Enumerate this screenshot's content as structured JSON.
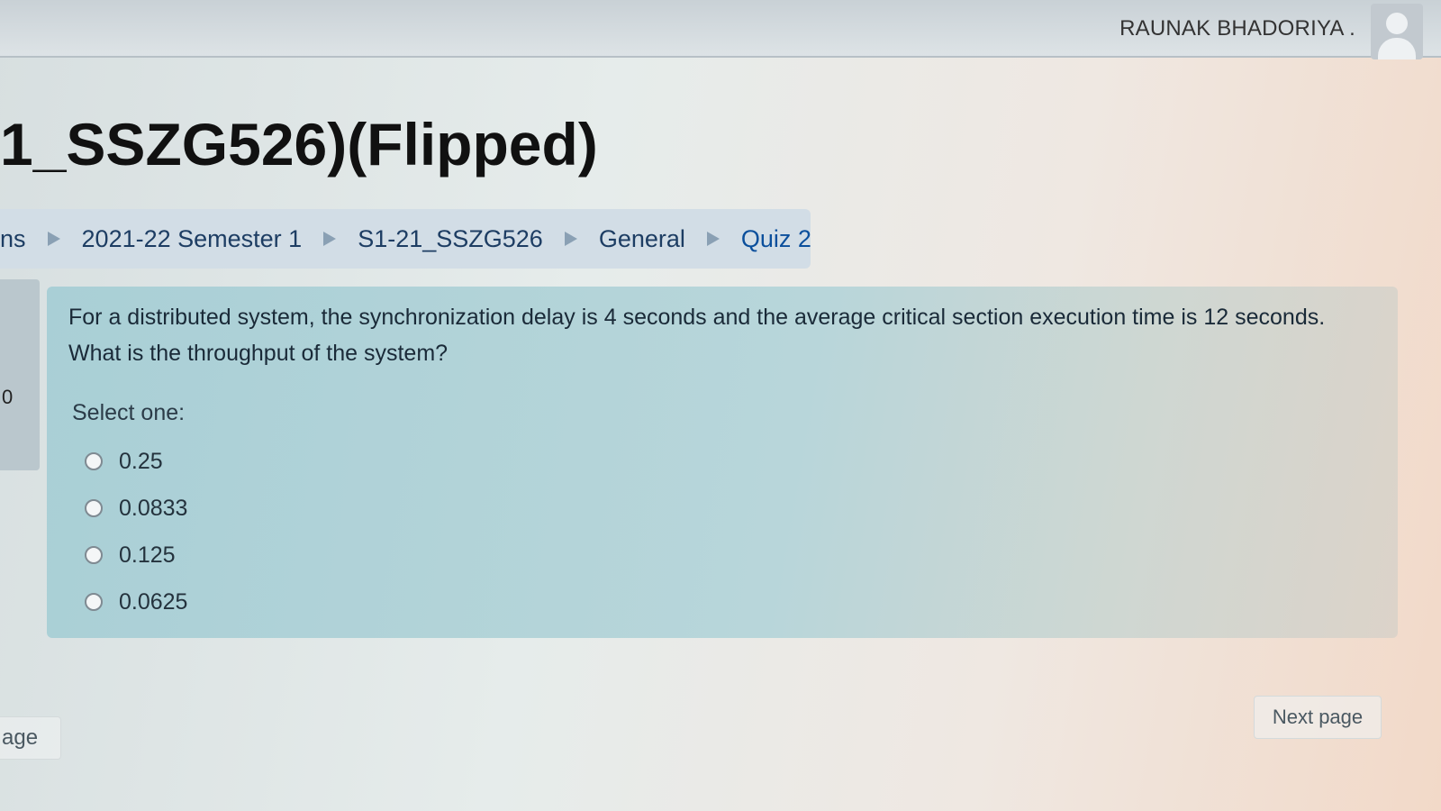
{
  "header": {
    "username": "RAUNAK BHADORIYA .",
    "avatar_icon": "user-avatar-icon"
  },
  "page": {
    "title": "1_SSZG526)(Flipped)"
  },
  "breadcrumb": {
    "items": [
      "ns",
      "2021-22 Semester 1",
      "S1-21_SSZG526",
      "General",
      "Quiz 2"
    ]
  },
  "sidebar": {
    "number": "0"
  },
  "question": {
    "text": "For a distributed system, the synchronization delay is 4 seconds and the average critical section execution time is 12 seconds. What is the throughput of the system?",
    "select_label": "Select one:",
    "options": [
      "0.25",
      "0.0833",
      "0.125",
      "0.0625"
    ]
  },
  "navigation": {
    "next_page": "Next page",
    "previous_page": "age"
  },
  "colors": {
    "card_bg": "#a9cfd6",
    "breadcrumb_bg": "#d2dde6",
    "link": "#0b4f9c"
  }
}
